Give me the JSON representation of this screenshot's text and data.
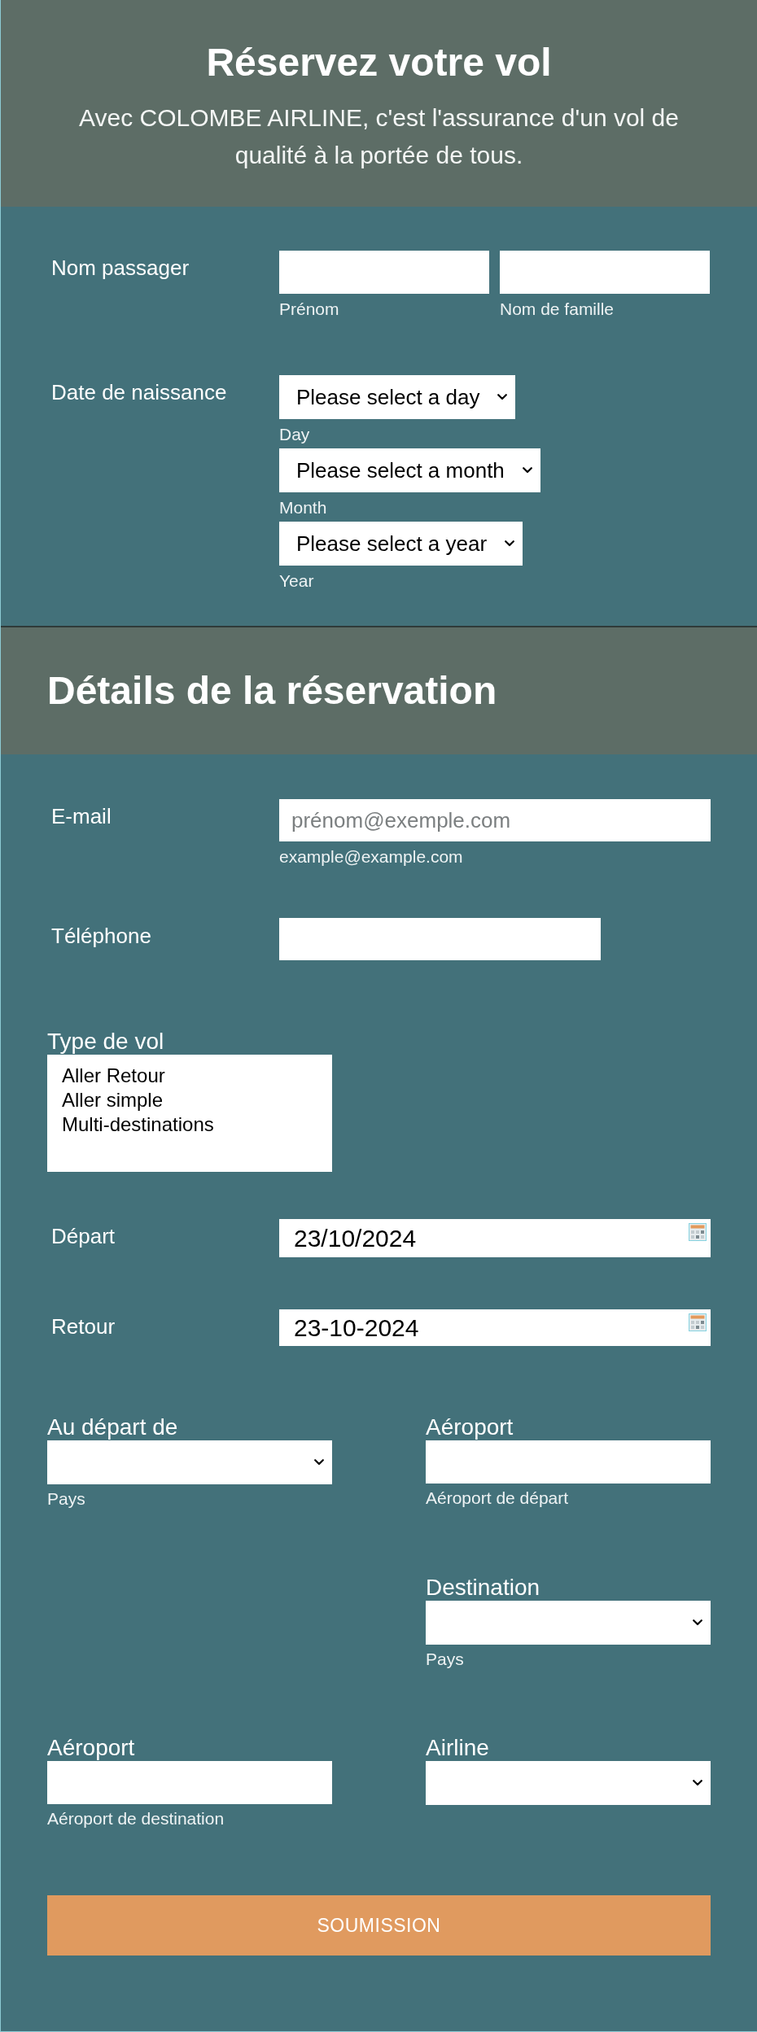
{
  "header": {
    "title": "Réservez votre vol",
    "subtitle": "Avec COLOMBE AIRLINE, c'est l'assurance d'un vol de qualité à la portée de tous."
  },
  "passenger": {
    "name": {
      "label": "Nom passager",
      "fields": [
        {
          "hint": "Prénom"
        },
        {
          "hint": "Nom de famille"
        }
      ]
    },
    "birth_date": {
      "label": "Date de naissance",
      "selects": [
        {
          "value": "Please select a day",
          "hint": "Day"
        },
        {
          "value": "Please select a month",
          "hint": "Month"
        },
        {
          "value": "Please select a year",
          "hint": "Year"
        }
      ]
    }
  },
  "booking": {
    "title": "Détails de la réservation",
    "email": {
      "label": "E-mail",
      "placeholder": "prénom@exemple.com",
      "hint": "example@example.com"
    },
    "phone": {
      "label": "Téléphone"
    },
    "flight_type": {
      "label": "Type de vol",
      "options": [
        {
          "label": "Aller Retour",
          "selected": false
        },
        {
          "label": "Aller simple",
          "selected": false
        },
        {
          "label": "Multi-destinations",
          "selected": false
        }
      ]
    },
    "dates": [
      {
        "label": "Départ",
        "value": "23/10/2024"
      },
      {
        "label": "Retour",
        "value": "23-10-2024"
      }
    ],
    "route": [
      {
        "left": {
          "kind": "select",
          "label": "Au départ de",
          "hint": "Pays"
        },
        "right": {
          "kind": "input",
          "label": "Aéroport",
          "hint": "Aéroport de départ"
        }
      },
      {
        "right": {
          "kind": "select",
          "label": "Destination",
          "hint": "Pays"
        }
      },
      {
        "left": {
          "kind": "input",
          "label": "Aéroport",
          "hint": "Aéroport de destination"
        },
        "right": {
          "kind": "select",
          "label": "Airline"
        }
      }
    ],
    "submit": "SOUMISSION"
  }
}
